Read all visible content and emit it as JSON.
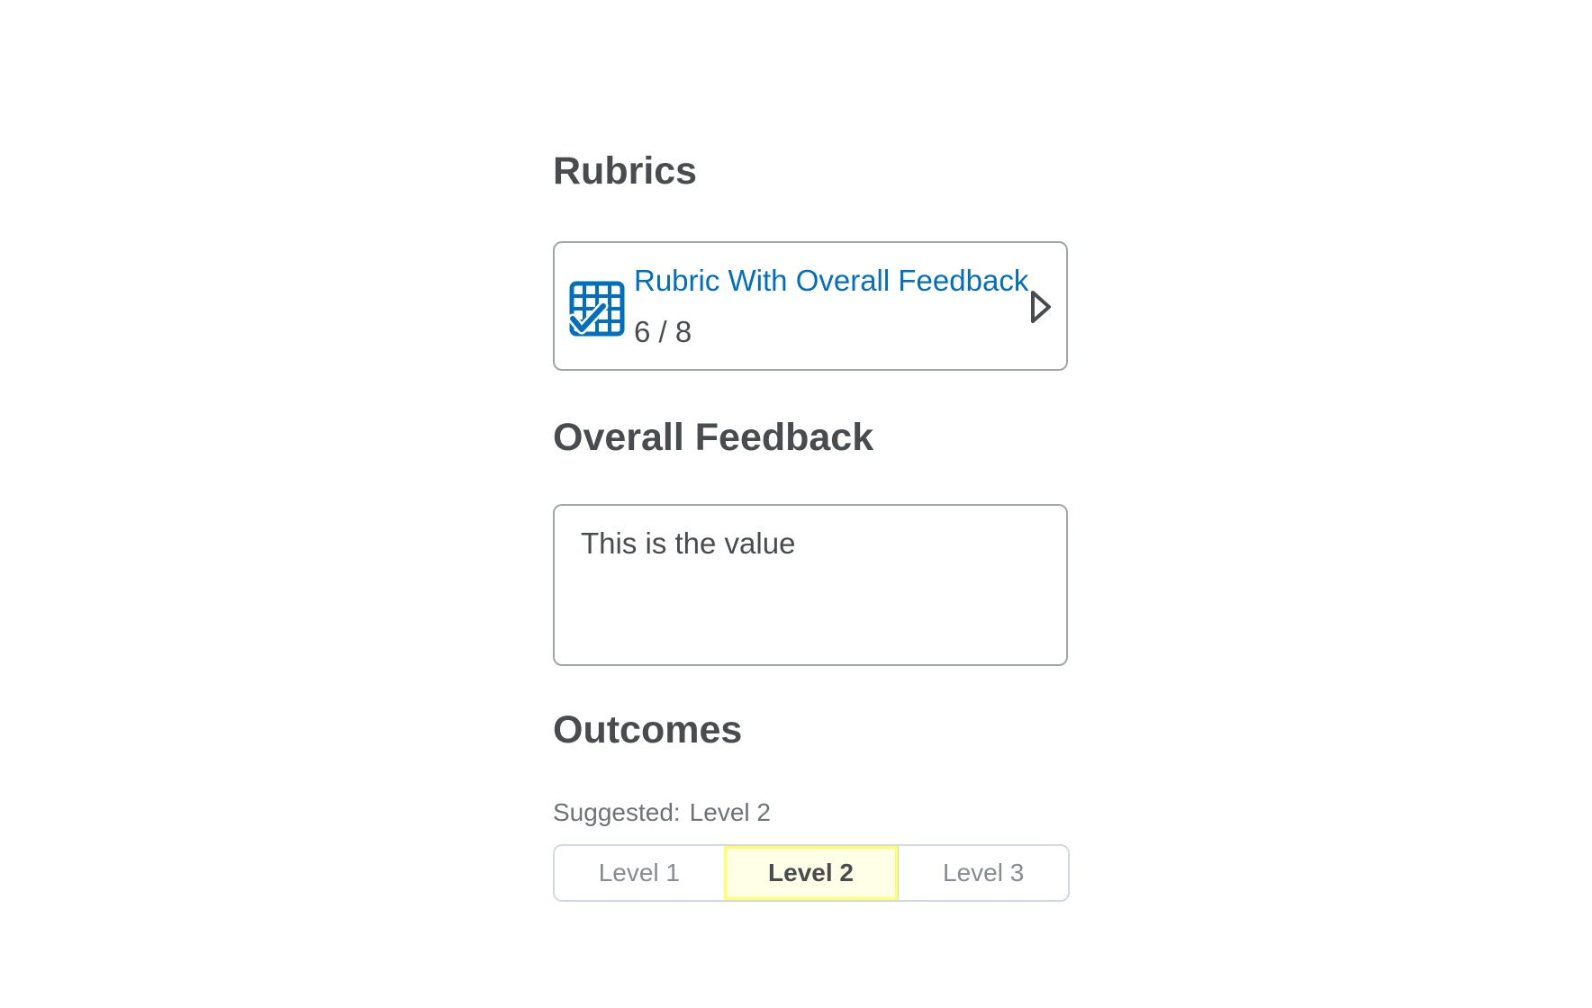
{
  "rubrics": {
    "heading": "Rubrics",
    "card": {
      "title": "Rubric With Overall Feedback",
      "score": "6 / 8",
      "icon": "rubric-grid-check-icon",
      "chevron_icon": "chevron-right-icon"
    }
  },
  "feedback": {
    "heading": "Overall Feedback",
    "value": "This is the value"
  },
  "outcomes": {
    "heading": "Outcomes",
    "suggested_label": "Suggested:",
    "suggested_value": "Level 2",
    "levels": [
      "Level 1",
      "Level 2",
      "Level 3"
    ],
    "selected_index": 1
  },
  "colors": {
    "link": "#006fbf",
    "text": "#494c4e",
    "selected_bg": "#fffee6",
    "selected_border": "#ffff66"
  }
}
